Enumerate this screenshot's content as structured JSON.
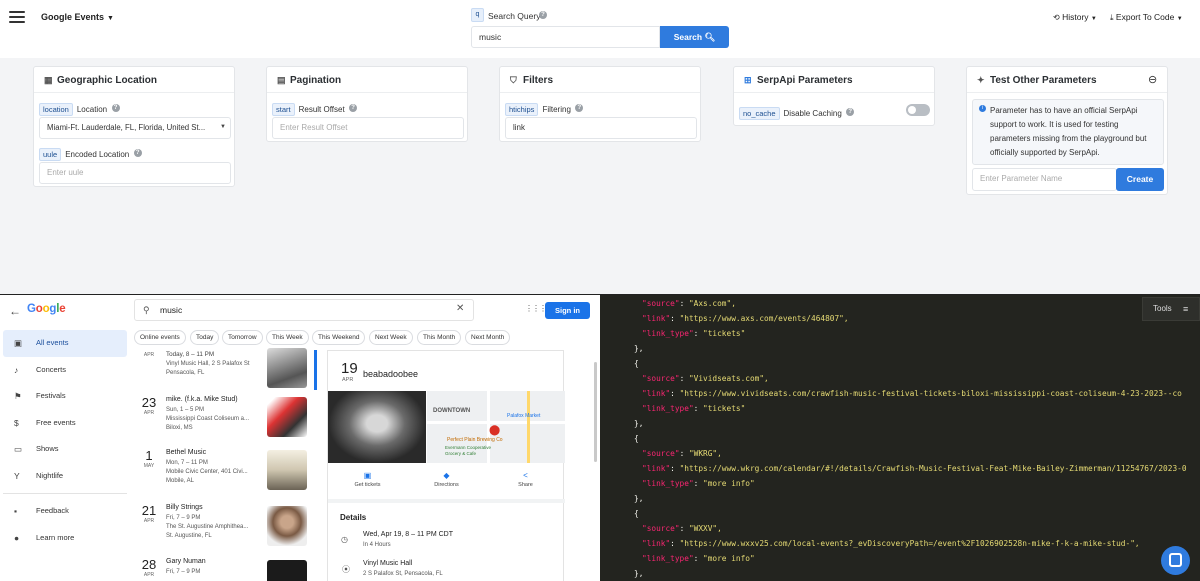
{
  "topbar": {
    "engine": "Google Events",
    "query_badge": "q",
    "query_label": "Search Query",
    "query_value": "music",
    "search_label": "Search",
    "history_label": "History",
    "export_label": "Export To Code"
  },
  "cards": {
    "geo": {
      "title": "Geographic Location",
      "location_tag": "location",
      "location_label": "Location",
      "location_value": "Miami-Ft. Lauderdale, FL, Florida, United St...",
      "uule_tag": "uule",
      "uule_label": "Encoded Location",
      "uule_placeholder": "Enter uule"
    },
    "pagination": {
      "title": "Pagination",
      "start_tag": "start",
      "start_label": "Result Offset",
      "start_placeholder": "Enter Result Offset"
    },
    "filters": {
      "title": "Filters",
      "htichips_tag": "htichips",
      "htichips_label": "Filtering",
      "htichips_value": "link"
    },
    "serpapi": {
      "title": "SerpApi Parameters",
      "nocache_tag": "no_cache",
      "nocache_label": "Disable Caching"
    },
    "test": {
      "title": "Test Other Parameters",
      "info": "Parameter has to have an official SerpApi support to work. It is used for testing parameters missing from the playground but officially supported by SerpApi.",
      "param_placeholder": "Enter Parameter Name",
      "create_label": "Create"
    }
  },
  "google": {
    "logo": "Google",
    "search_value": "music",
    "signin": "Sign in",
    "nav": [
      {
        "label": "All events",
        "icon": "calendar-icon"
      },
      {
        "label": "Concerts",
        "icon": "music-note-icon"
      },
      {
        "label": "Festivals",
        "icon": "flag-icon"
      },
      {
        "label": "Free events",
        "icon": "dollar-icon"
      },
      {
        "label": "Shows",
        "icon": "ticket-icon"
      },
      {
        "label": "Nightlife",
        "icon": "cocktail-icon"
      },
      {
        "label": "Feedback",
        "icon": "feedback-icon"
      },
      {
        "label": "Learn more",
        "icon": "help-icon"
      }
    ],
    "chips": [
      "Online events",
      "Today",
      "Tomorrow",
      "This Week",
      "This Weekend",
      "Next Week",
      "This Month",
      "Next Month"
    ],
    "events": [
      {
        "day": "",
        "month": "APR",
        "title": "Today, 8 – 11 PM",
        "line1": "Vinyl Music Hall, 2 S Palafox St",
        "line2": "Pensacola, FL"
      },
      {
        "day": "23",
        "month": "APR",
        "title": "mike. (f.k.a. Mike Stud)",
        "line1": "Sun, 1 – 5 PM",
        "line2": "Mississippi Coast Coliseum a...",
        "line3": "Biloxi, MS"
      },
      {
        "day": "1",
        "month": "MAY",
        "title": "Bethel Music",
        "line1": "Mon, 7 – 11 PM",
        "line2": "Mobile Civic Center, 401 Civi...",
        "line3": "Mobile, AL"
      },
      {
        "day": "21",
        "month": "APR",
        "title": "Billy Strings",
        "line1": "Fri, 7 – 9 PM",
        "line2": "The St. Augustine Amphithea...",
        "line3": "St. Augustine, FL"
      },
      {
        "day": "28",
        "month": "APR",
        "title": "Gary Numan",
        "line1": "Fri, 7 – 9 PM",
        "line2": "",
        "line3": ""
      }
    ],
    "detail": {
      "day": "19",
      "month": "APR",
      "title": "beabadoobee",
      "map_label": "DOWNTOWN",
      "map_place1": "Palafox Market",
      "map_place2": "Perfect Plain Brewing Co",
      "map_place3": "Evermann Cooperative Grocery & Cafe",
      "actions": [
        "Get tickets",
        "Directions",
        "Share"
      ],
      "details_heading": "Details",
      "when": "Wed, Apr 19, 8 – 11 PM CDT",
      "when_sub": "In 4 Hours",
      "where": "Vinyl Music Hall",
      "where_sub": "2 S Palafox St, Pensacola, FL"
    }
  },
  "json_view": {
    "tools_label": "Tools",
    "lines": [
      {
        "indent": 3,
        "key": "\"source\"",
        "value": "\"Axs.com\","
      },
      {
        "indent": 3,
        "key": "\"link\"",
        "value": "\"https://www.axs.com/events/464807\","
      },
      {
        "indent": 3,
        "key": "\"link_type\"",
        "value": "\"tickets\""
      },
      {
        "indent": 2,
        "punct": "},"
      },
      {
        "indent": 2,
        "punct": "{"
      },
      {
        "indent": 3,
        "key": "\"source\"",
        "value": "\"Vividseats.com\","
      },
      {
        "indent": 3,
        "key": "\"link\"",
        "value": "\"https://www.vividseats.com/crawfish-music-festival-tickets-biloxi-mississippi-coast-coliseum-4-23-2023--co"
      },
      {
        "indent": 3,
        "key": "\"link_type\"",
        "value": "\"tickets\""
      },
      {
        "indent": 2,
        "punct": "},"
      },
      {
        "indent": 2,
        "punct": "{"
      },
      {
        "indent": 3,
        "key": "\"source\"",
        "value": "\"WKRG\","
      },
      {
        "indent": 3,
        "key": "\"link\"",
        "value": "\"https://www.wkrg.com/calendar/#!/details/Crawfish-Music-Festival-Feat-Mike-Bailey-Zimmerman/11254767/2023-0"
      },
      {
        "indent": 3,
        "key": "\"link_type\"",
        "value": "\"more info\""
      },
      {
        "indent": 2,
        "punct": "},"
      },
      {
        "indent": 2,
        "punct": "{"
      },
      {
        "indent": 3,
        "key": "\"source\"",
        "value": "\"WXXV\","
      },
      {
        "indent": 3,
        "key": "\"link\"",
        "value": "\"https://www.wxxv25.com/local-events?_evDiscoveryPath=/event%2F1026902528n-mike-f-k-a-mike-stud-\","
      },
      {
        "indent": 3,
        "key": "\"link_type\"",
        "value": "\"more info\""
      },
      {
        "indent": 2,
        "punct": "},"
      }
    ]
  }
}
